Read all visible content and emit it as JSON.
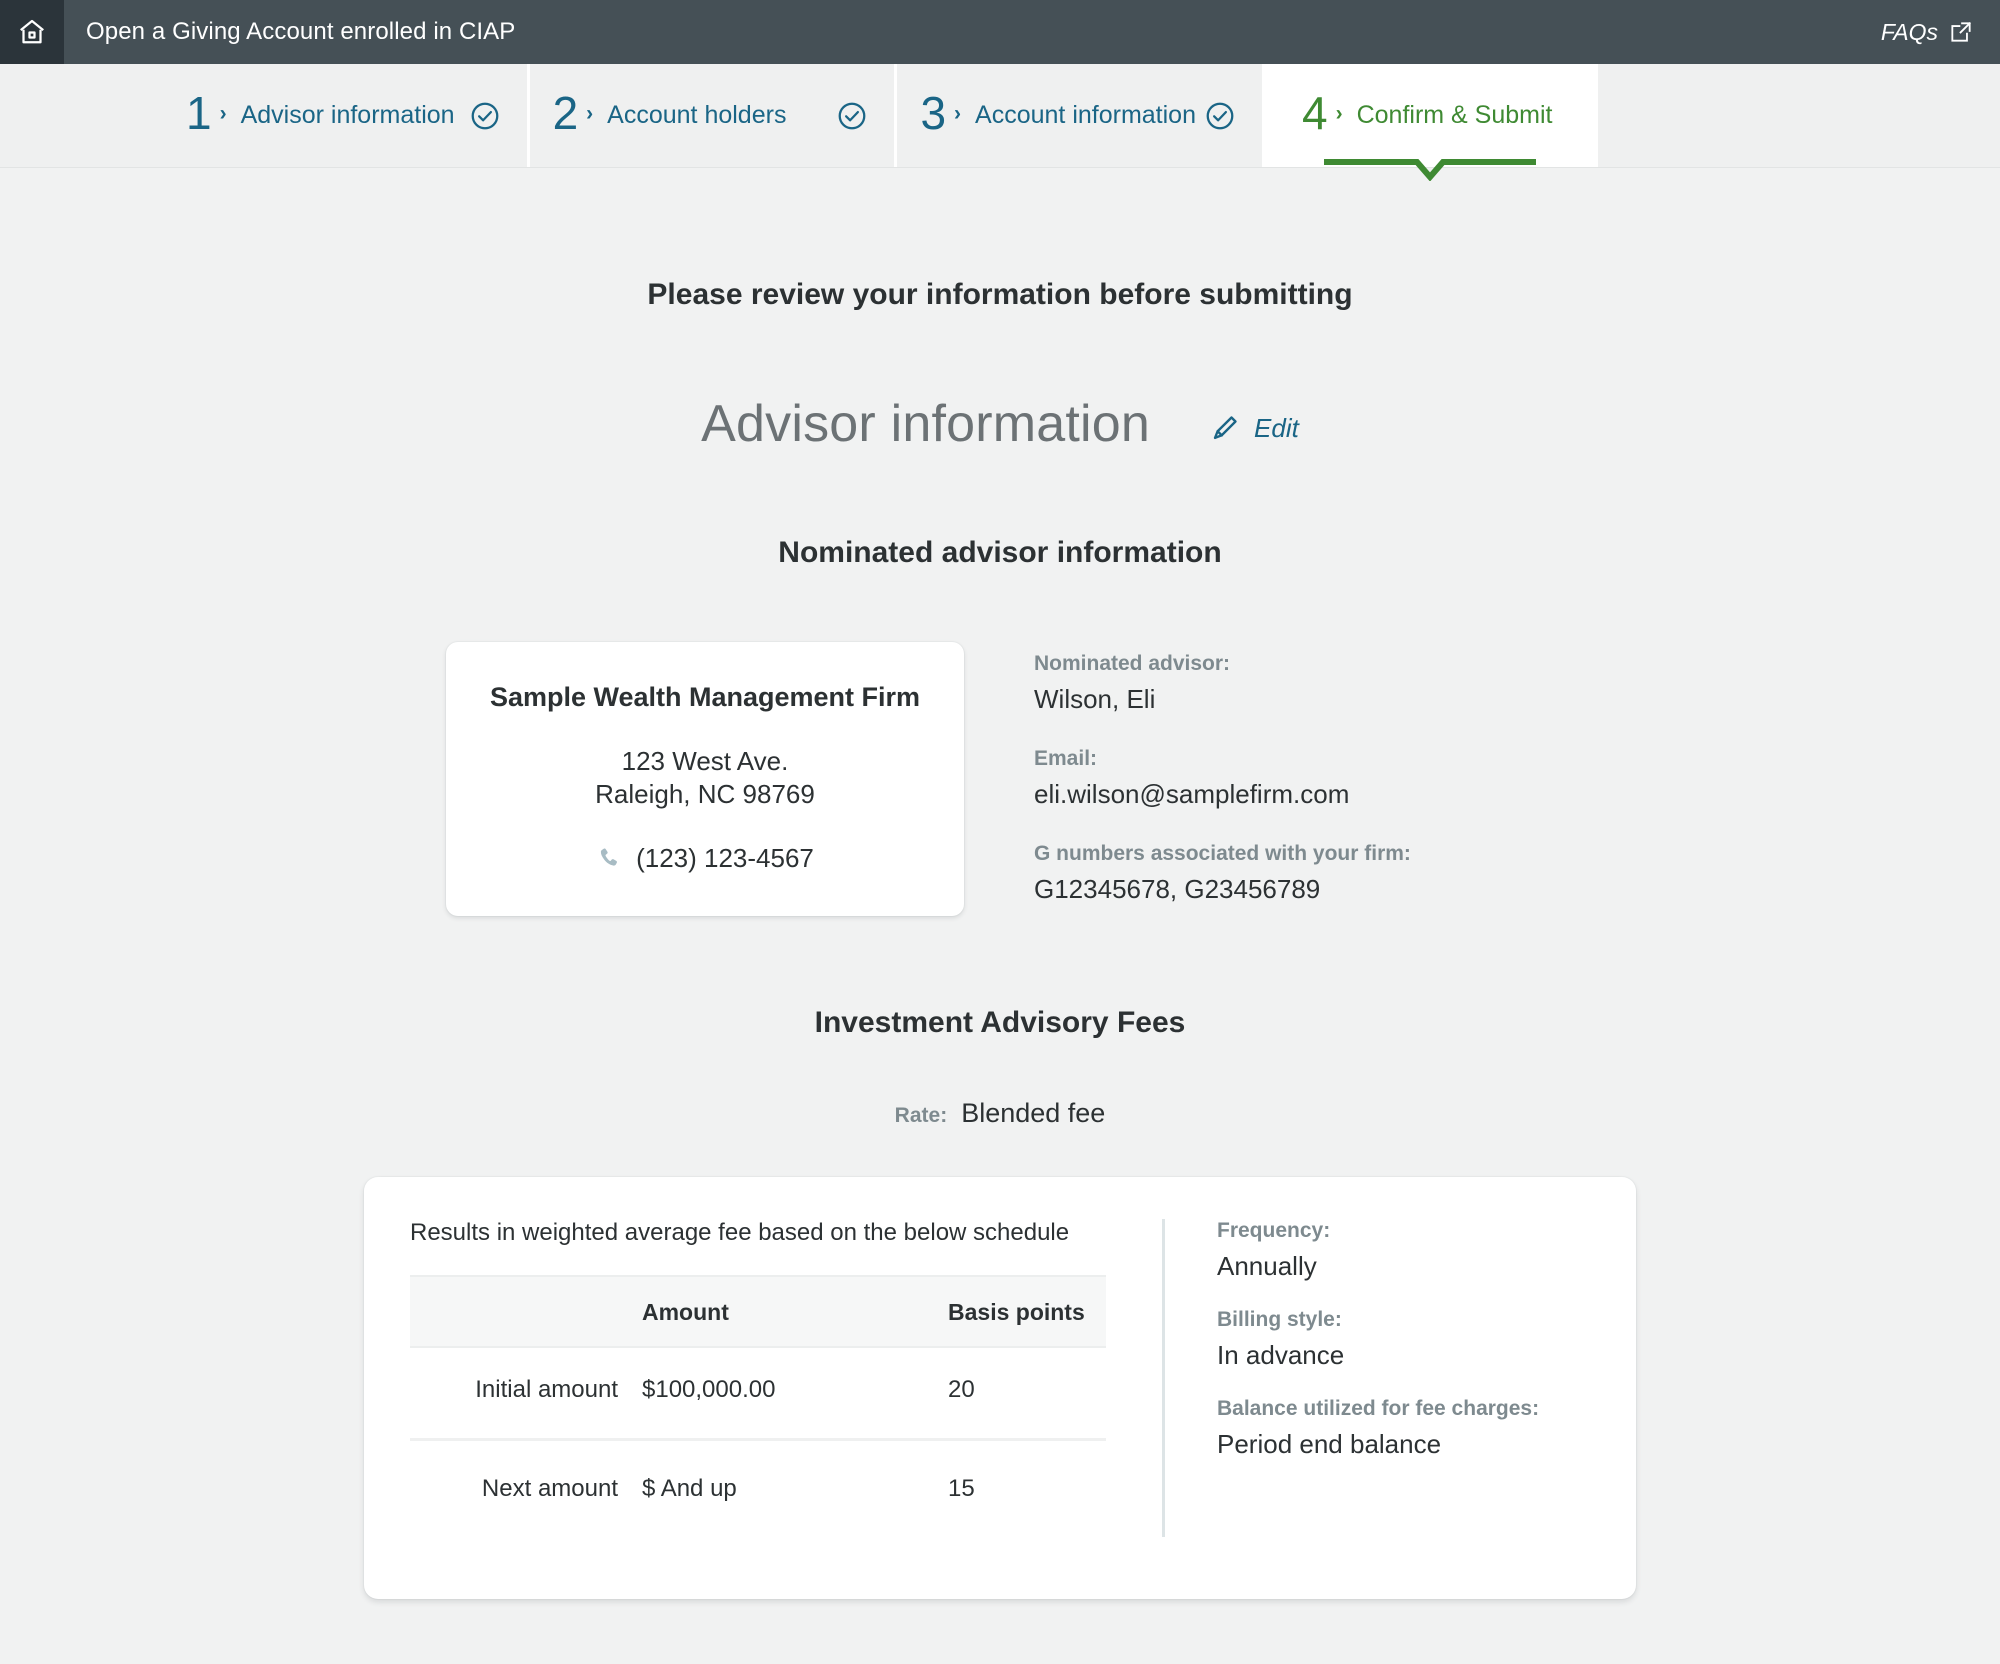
{
  "appbar": {
    "home_icon": "home-icon",
    "title": "Open a Giving Account enrolled in CIAP",
    "faqs_label": "FAQs",
    "faqs_icon": "external-link-icon"
  },
  "stepper": {
    "steps": [
      {
        "number": "1",
        "caret": "›",
        "label": "Advisor information",
        "state": "done",
        "check_icon": "check-circle-icon"
      },
      {
        "number": "2",
        "caret": "›",
        "label": "Account holders",
        "state": "done",
        "check_icon": "check-circle-icon"
      },
      {
        "number": "3",
        "caret": "›",
        "label": "Account information",
        "state": "done",
        "check_icon": "check-circle-icon"
      },
      {
        "number": "4",
        "caret": "›",
        "label": "Confirm & Submit",
        "state": "active",
        "check_icon": ""
      }
    ]
  },
  "main": {
    "review_title": "Please review your information before submitting",
    "section_title": "Advisor information",
    "edit_label": "Edit",
    "edit_icon": "pencil-icon",
    "sub_title": "Nominated advisor information",
    "firm": {
      "name": "Sample Wealth Management Firm",
      "address_line1": "123 West Ave.",
      "address_line2": "Raleigh, NC 98769",
      "phone": "(123) 123-4567",
      "phone_icon": "phone-icon"
    },
    "advisor_fields": [
      {
        "label": "Nominated advisor:",
        "value": "Wilson, Eli"
      },
      {
        "label": "Email:",
        "value": "eli.wilson@samplefirm.com"
      },
      {
        "label": "G numbers associated with your firm:",
        "value": "G12345678, G23456789"
      }
    ],
    "fees": {
      "title": "Investment Advisory Fees",
      "rate_label": "Rate:",
      "rate_value": "Blended fee",
      "note": "Results in weighted average fee based on the below schedule",
      "table": {
        "headers": [
          "",
          "Amount",
          "Basis points"
        ],
        "rows": [
          {
            "row_label": "Initial amount",
            "amount": "$100,000.00",
            "basis_points": "20"
          },
          {
            "row_label": "Next amount",
            "amount": "$ And up",
            "basis_points": "15"
          }
        ]
      },
      "details": [
        {
          "label": "Frequency:",
          "value": "Annually"
        },
        {
          "label": "Billing style:",
          "value": "In advance"
        },
        {
          "label": "Balance utilized for fee charges:",
          "value": "Period end balance"
        }
      ]
    }
  },
  "colors": {
    "appbar_bg": "#455056",
    "home_bg": "#2b343a",
    "page_bg": "#f1f2f2",
    "step_link": "#1a6586",
    "step_active": "#3f8a33",
    "label_gray": "#7e8a8f",
    "text_dark": "#2c3133"
  }
}
